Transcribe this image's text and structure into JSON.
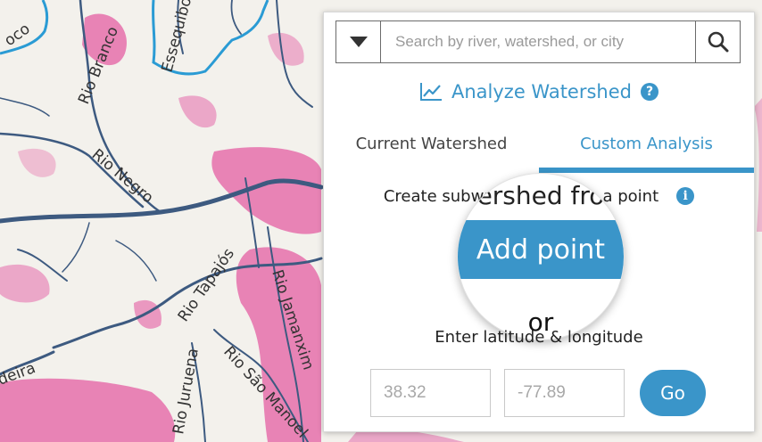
{
  "map": {
    "rivers": [
      "Rio Branco",
      "Essequibo",
      "Rio Negro",
      "Rio Tapajós",
      "Rio Jamanxim",
      "Rio Juruena",
      "Rio São Manoel"
    ],
    "partial_labels": [
      "oco",
      "deira"
    ],
    "colors": {
      "land": "#f3f1ec",
      "forest_loss": "#e45ea3",
      "river": "#3d5a80",
      "boundary": "#2a9bd4"
    }
  },
  "search": {
    "placeholder": "Search by river, watershed, or city",
    "dropdown_icon": "caret-down-icon",
    "search_icon": "magnifier-icon"
  },
  "analyze": {
    "title": "Analyze Watershed",
    "icon": "line-chart-icon",
    "help": "?"
  },
  "tabs": {
    "current": "Current Watershed",
    "custom": "Custom Analysis",
    "active": "custom"
  },
  "custom": {
    "subwatershed_label": "Create subwatershed from a point",
    "info_symbol": "i",
    "magnifier_text": "ershed fro",
    "add_point_label": "Add point",
    "or_label": "or",
    "latlng_label": "Enter latitude & longitude",
    "lat_placeholder": "38.32",
    "lng_placeholder": "-77.89",
    "go_label": "Go"
  },
  "accent_color": "#3a95c9"
}
